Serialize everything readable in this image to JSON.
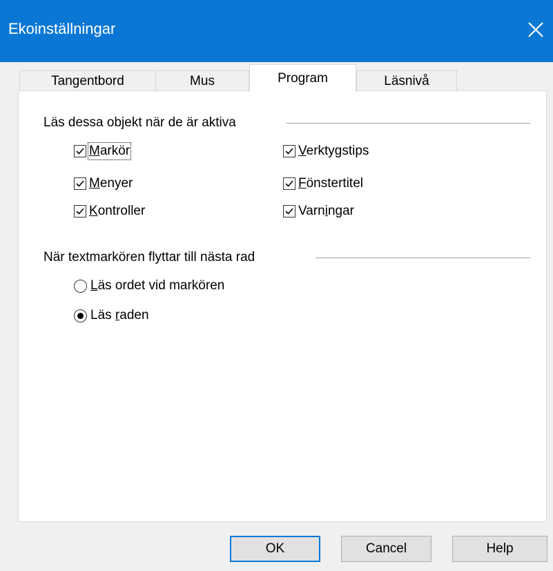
{
  "window": {
    "title": "Ekoinställningar"
  },
  "tabs": [
    {
      "label": "Tangentbord",
      "active": false
    },
    {
      "label": "Mus",
      "active": false
    },
    {
      "label": "Program",
      "active": true
    },
    {
      "label": "Läsnivå",
      "active": false
    }
  ],
  "group1": {
    "title": "Läs dessa objekt när de är aktiva",
    "items": [
      {
        "pre": "",
        "mn": "M",
        "post": "arkör",
        "checked": true
      },
      {
        "pre": "",
        "mn": "M",
        "post": "enyer",
        "checked": true
      },
      {
        "pre": "",
        "mn": "K",
        "post": "ontroller",
        "checked": true
      },
      {
        "pre": "",
        "mn": "V",
        "post": "erktygstips",
        "checked": true
      },
      {
        "pre": "",
        "mn": "F",
        "post": "önstertitel",
        "checked": true
      },
      {
        "pre": "Varn",
        "mn": "i",
        "post": "ngar",
        "checked": true
      }
    ]
  },
  "group2": {
    "title": "När textmarkören flyttar till nästa rad",
    "options": [
      {
        "pre": "",
        "mn": "L",
        "post": "äs ordet vid markören",
        "selected": false
      },
      {
        "pre": "Läs ",
        "mn": "r",
        "post": "aden",
        "selected": true
      }
    ]
  },
  "buttons": {
    "ok": "OK",
    "cancel": "Cancel",
    "help": "Help"
  }
}
